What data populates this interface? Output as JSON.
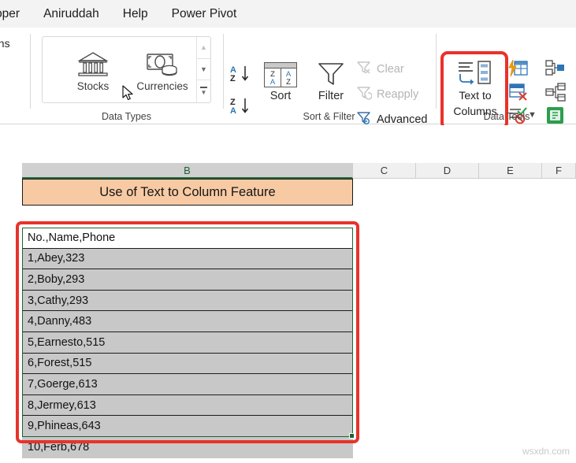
{
  "ribbon": {
    "tabs": [
      {
        "label": "eloper",
        "name": "tab-developer"
      },
      {
        "label": "Aniruddah",
        "name": "tab-aniruddah"
      },
      {
        "label": "Help",
        "name": "tab-help"
      },
      {
        "label": "Power Pivot",
        "name": "tab-power-pivot"
      }
    ],
    "queries_group": {
      "clipped_label": "ons"
    },
    "data_types": {
      "group_label": "Data Types",
      "items": [
        {
          "label": "Stocks",
          "icon": "bank-stocks-icon"
        },
        {
          "label": "Currencies",
          "icon": "currencies-icon"
        }
      ],
      "scroll": {
        "up": "chevron-up-icon",
        "down": "chevron-down-icon",
        "more": "gallery-more-icon"
      }
    },
    "sort_filter": {
      "group_label": "Sort & Filter",
      "sort_asc": "A\nZ",
      "sort_desc": "Z\nA",
      "sort_label": "Sort",
      "filter_label": "Filter",
      "clear_label": "Clear",
      "reapply_label": "Reapply",
      "advanced_label": "Advanced",
      "disabled": [
        "Clear",
        "Reapply"
      ]
    },
    "data_tools": {
      "group_label": "Data Tools",
      "text_to_columns_line1": "Text to",
      "text_to_columns_line2": "Columns",
      "highlighted": "text-to-columns-button",
      "icons": [
        "flash-fill-icon",
        "remove-duplicates-icon",
        "data-validation-icon",
        "data-validation-dropdown-icon",
        "consolidate-icon",
        "relationships-icon",
        "manage-data-model-icon"
      ]
    }
  },
  "grid": {
    "columns": [
      {
        "label": "B",
        "selected": true
      },
      {
        "label": "C",
        "selected": false
      },
      {
        "label": "D",
        "selected": false
      },
      {
        "label": "E",
        "selected": false
      },
      {
        "label": "F",
        "selected": false
      }
    ],
    "title_cell": "Use of Text to Column Feature",
    "rows": [
      "No.,Name,Phone",
      "1,Abey,323",
      "2,Boby,293",
      "3,Cathy,293",
      "4,Danny,483",
      "5,Earnesto,515",
      "6,Forest,515",
      "7,Goerge,613",
      "8,Jermey,613",
      "9,Phineas,643",
      "10,Ferb,678"
    ]
  },
  "watermark": "wsxdn.com",
  "colors": {
    "highlight_red": "#e8322a",
    "title_fill": "#f8caa4",
    "selection_green": "#1d6135",
    "row_fill": "#c8c8c8",
    "accent_blue": "#2e75b6"
  }
}
